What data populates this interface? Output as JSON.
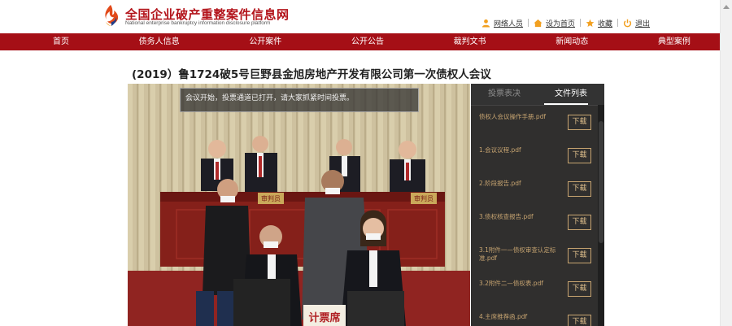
{
  "header": {
    "site_title": "全国企业破产重整案件信息网",
    "site_subtitle": "National enterprise bankruptcy information disclosure platform",
    "top_links": [
      {
        "label": "网络人员",
        "icon": "user-icon"
      },
      {
        "label": "设为首页",
        "icon": "home-icon"
      },
      {
        "label": "收藏",
        "icon": "star-icon"
      },
      {
        "label": "退出",
        "icon": "power-icon"
      }
    ]
  },
  "nav": {
    "items": [
      "首页",
      "债务人信息",
      "公开案件",
      "公开公告",
      "裁判文书",
      "新闻动态",
      "典型案例"
    ]
  },
  "meeting": {
    "title": "(2019）鲁1724破5号巨野县金旭房地产开发有限公司第一次债权人会议",
    "overlay_message": "会议开始，投票通道已打开，请大家抓紧时间投票。"
  },
  "panel": {
    "tabs": [
      {
        "label": "投票表决",
        "active": false
      },
      {
        "label": "文件列表",
        "active": true
      }
    ],
    "download_label": "下载",
    "files": [
      "债权人会议操作手册.pdf",
      "1.会议议程.pdf",
      "2.阶段报告.pdf",
      "3.债权核查报告.pdf",
      "3.1附件一—债权审查认定标准.pdf",
      "3.2附件二—债权表.pdf",
      "4.主席推荐函.pdf"
    ]
  },
  "video_scene": {
    "sign_bench_left": "审判员",
    "sign_bench_right": "审判员",
    "sign_desk": "计票席"
  },
  "colors": {
    "brand_red": "#a50f16",
    "title_red": "#b3141b",
    "panel_bg": "#2b2b2b",
    "file_gold": "#c8a571"
  }
}
